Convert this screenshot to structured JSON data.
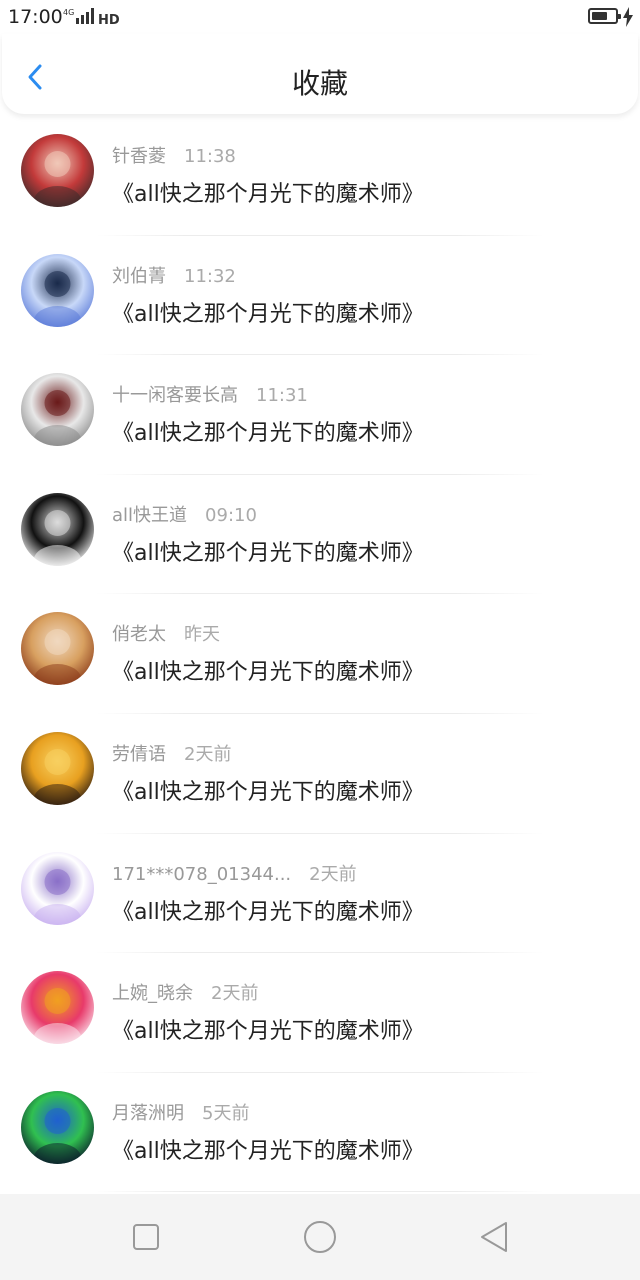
{
  "status": {
    "time": "17:00",
    "network": "4G",
    "hd": "HD",
    "battery_level": 0.7
  },
  "header": {
    "title": "收藏",
    "back_icon": "chevron-left-icon",
    "accent_color": "#2b8cf0"
  },
  "favorites": [
    {
      "user": "针香菱",
      "time": "11:38",
      "title": "《all快之那个月光下的魔术师》",
      "avatar_colors": [
        "#3a2a2a",
        "#c33a3a",
        "#f0c8b8"
      ]
    },
    {
      "user": "刘伯菁",
      "time": "11:32",
      "title": "《all快之那个月光下的魔术师》",
      "avatar_colors": [
        "#5a7ad8",
        "#c8d8f8",
        "#1a2a4a"
      ]
    },
    {
      "user": "十一闲客要长高",
      "time": "11:31",
      "title": "《all快之那个月光下的魔术师》",
      "avatar_colors": [
        "#888888",
        "#e8e8e8",
        "#6a1a1a"
      ]
    },
    {
      "user": "all快王道",
      "time": "09:10",
      "title": "《all快之那个月光下的魔术师》",
      "avatar_colors": [
        "#ffffff",
        "#111111",
        "#dddddd"
      ]
    },
    {
      "user": "俏老太",
      "time": "昨天",
      "title": "《all快之那个月光下的魔术师》",
      "avatar_colors": [
        "#8a3a1a",
        "#d8a060",
        "#f0d8c0"
      ]
    },
    {
      "user": "劳倩语",
      "time": "2天前",
      "title": "《all快之那个月光下的魔术师》",
      "avatar_colors": [
        "#2a1a10",
        "#e8a020",
        "#f8d060"
      ]
    },
    {
      "user": "171***078_01344...",
      "time": "2天前",
      "title": "《all快之那个月光下的魔术师》",
      "avatar_colors": [
        "#c8b0f0",
        "#ffffff",
        "#8a70c8"
      ]
    },
    {
      "user": "上婉_晓余",
      "time": "2天前",
      "title": "《all快之那个月光下的魔术师》",
      "avatar_colors": [
        "#fbe8f0",
        "#e83a6a",
        "#f0a020"
      ]
    },
    {
      "user": "月落洲明",
      "time": "5天前",
      "title": "《all快之那个月光下的魔术师》",
      "avatar_colors": [
        "#0a1a2a",
        "#30c050",
        "#2060d0"
      ]
    }
  ],
  "nav": {
    "recent_icon": "square-icon",
    "home_icon": "circle-icon",
    "back_icon": "triangle-back-icon"
  }
}
